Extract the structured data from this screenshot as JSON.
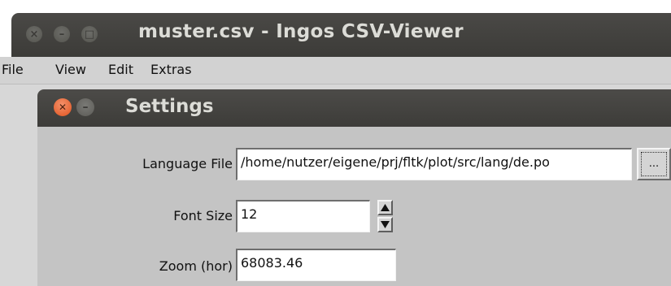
{
  "main_window": {
    "title": "muster.csv - Ingos CSV-Viewer",
    "menu": [
      "File",
      "View",
      "Edit",
      "Extras"
    ]
  },
  "settings_dialog": {
    "title": "Settings",
    "language_file": {
      "label": "Language File",
      "value": "/home/nutzer/eigene/prj/fltk/plot/src/lang/de.po",
      "browse_label": "..."
    },
    "font_size": {
      "label": "Font Size",
      "value": "12"
    },
    "zoom_hor": {
      "label": "Zoom (hor)",
      "value": "68083.46"
    }
  },
  "icons": {
    "window_close": "close-icon",
    "window_minimize": "minimize-icon",
    "window_maximize": "maximize-icon",
    "spin_up": "triangle-up-icon",
    "spin_down": "triangle-down-icon"
  },
  "colors": {
    "titlebar": "#3c3b38",
    "dialog_close": "#e0531f",
    "dialog_body": "#c4c4c4"
  }
}
